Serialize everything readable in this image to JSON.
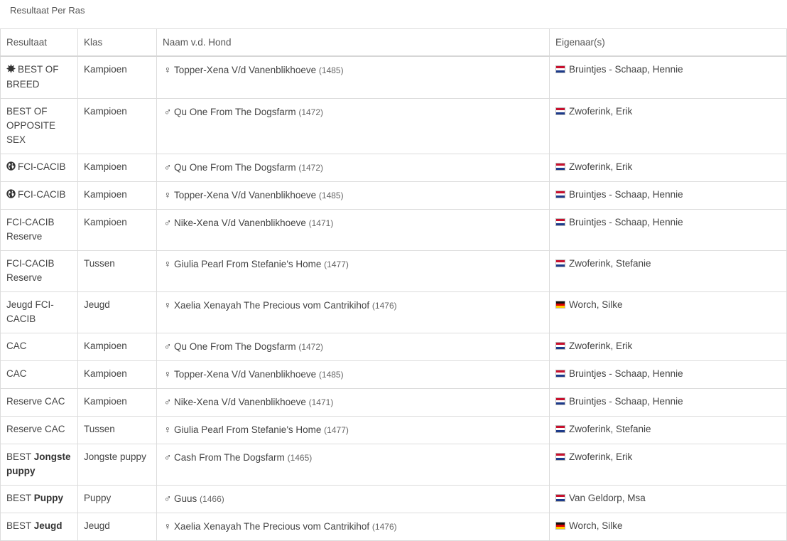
{
  "page": {
    "title": "Resultaat Per Ras"
  },
  "table": {
    "headers": [
      "Resultaat",
      "Klas",
      "Naam v.d. Hond",
      "Eigenaar(s)"
    ],
    "rows": [
      {
        "icon": "award-burst-icon",
        "result": "BEST OF BREED",
        "result_bold": "",
        "klas": "Kampioen",
        "sex": "♀",
        "dog": "Topper-Xena V/d Vanenblikhoeve",
        "num": "(1485)",
        "flag": "nl",
        "owner": "Bruintjes - Schaap, Hennie"
      },
      {
        "icon": "",
        "result": "BEST OF OPPOSITE SEX",
        "result_bold": "",
        "klas": "Kampioen",
        "sex": "♂",
        "dog": "Qu One From The Dogsfarm",
        "num": "(1472)",
        "flag": "nl",
        "owner": "Zwoferink, Erik"
      },
      {
        "icon": "globe-icon",
        "result": "FCI-CACIB",
        "result_bold": "",
        "klas": "Kampioen",
        "sex": "♂",
        "dog": "Qu One From The Dogsfarm",
        "num": "(1472)",
        "flag": "nl",
        "owner": "Zwoferink, Erik"
      },
      {
        "icon": "globe-icon",
        "result": "FCI-CACIB",
        "result_bold": "",
        "klas": "Kampioen",
        "sex": "♀",
        "dog": "Topper-Xena V/d Vanenblikhoeve",
        "num": "(1485)",
        "flag": "nl",
        "owner": "Bruintjes - Schaap, Hennie"
      },
      {
        "icon": "",
        "result": "FCI-CACIB Reserve",
        "result_bold": "",
        "klas": "Kampioen",
        "sex": "♂",
        "dog": "Nike-Xena V/d Vanenblikhoeve",
        "num": "(1471)",
        "flag": "nl",
        "owner": "Bruintjes - Schaap, Hennie"
      },
      {
        "icon": "",
        "result": "FCI-CACIB Reserve",
        "result_bold": "",
        "klas": "Tussen",
        "sex": "♀",
        "dog": "Giulia Pearl From Stefanie's Home",
        "num": "(1477)",
        "flag": "nl",
        "owner": "Zwoferink, Stefanie"
      },
      {
        "icon": "",
        "result": "Jeugd FCI-CACIB",
        "result_bold": "",
        "klas": "Jeugd",
        "sex": "♀",
        "dog": "Xaelia Xenayah The Precious vom Cantrikihof",
        "num": "(1476)",
        "flag": "de",
        "owner": "Worch, Silke"
      },
      {
        "icon": "",
        "result": "CAC",
        "result_bold": "",
        "klas": "Kampioen",
        "sex": "♂",
        "dog": "Qu One From The Dogsfarm",
        "num": "(1472)",
        "flag": "nl",
        "owner": "Zwoferink, Erik"
      },
      {
        "icon": "",
        "result": "CAC",
        "result_bold": "",
        "klas": "Kampioen",
        "sex": "♀",
        "dog": "Topper-Xena V/d Vanenblikhoeve",
        "num": "(1485)",
        "flag": "nl",
        "owner": "Bruintjes - Schaap, Hennie"
      },
      {
        "icon": "",
        "result": "Reserve CAC",
        "result_bold": "",
        "klas": "Kampioen",
        "sex": "♂",
        "dog": "Nike-Xena V/d Vanenblikhoeve",
        "num": "(1471)",
        "flag": "nl",
        "owner": "Bruintjes - Schaap, Hennie"
      },
      {
        "icon": "",
        "result": "Reserve CAC",
        "result_bold": "",
        "klas": "Tussen",
        "sex": "♀",
        "dog": "Giulia Pearl From Stefanie's Home",
        "num": "(1477)",
        "flag": "nl",
        "owner": "Zwoferink, Stefanie"
      },
      {
        "icon": "",
        "result": "BEST",
        "result_bold": "Jongste puppy",
        "klas": "Jongste puppy",
        "sex": "♂",
        "dog": "Cash From The Dogsfarm",
        "num": "(1465)",
        "flag": "nl",
        "owner": "Zwoferink, Erik"
      },
      {
        "icon": "",
        "result": "BEST",
        "result_bold": "Puppy",
        "klas": "Puppy",
        "sex": "♂",
        "dog": "Guus",
        "num": "(1466)",
        "flag": "nl",
        "owner": "Van Geldorp, Msa"
      },
      {
        "icon": "",
        "result": "BEST",
        "result_bold": "Jeugd",
        "klas": "Jeugd",
        "sex": "♀",
        "dog": "Xaelia Xenayah The Precious vom Cantrikihof",
        "num": "(1476)",
        "flag": "de",
        "owner": "Worch, Silke"
      }
    ]
  }
}
